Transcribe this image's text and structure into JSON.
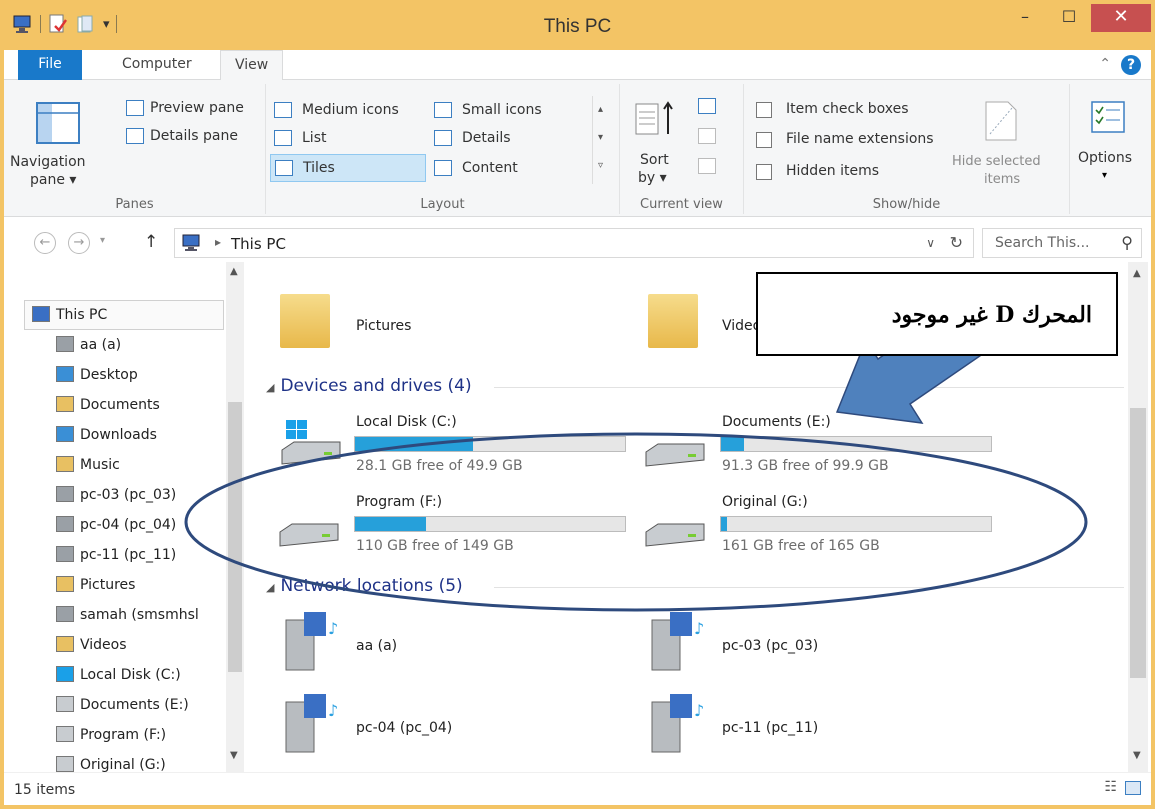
{
  "window": {
    "title": "This PC",
    "close_glyph": "✕",
    "min_glyph": "–",
    "max_glyph": "☐"
  },
  "tabs": {
    "file": "File",
    "computer": "Computer",
    "view": "View"
  },
  "ribbon": {
    "panes": {
      "navigation_pane": "Navigation",
      "navigation_pane2": "pane ▾",
      "preview_pane": "Preview pane",
      "details_pane": "Details pane",
      "group_label": "Panes"
    },
    "layout": {
      "medium_icons": "Medium icons",
      "small_icons": "Small icons",
      "list": "List",
      "details": "Details",
      "tiles": "Tiles",
      "content": "Content",
      "group_label": "Layout"
    },
    "current_view": {
      "sort_by": "Sort",
      "sort_by2": "by ▾",
      "group_label": "Current view"
    },
    "show_hide": {
      "item_check_boxes": "Item check boxes",
      "file_name_extensions": "File name extensions",
      "hidden_items": "Hidden items",
      "hide_selected": "Hide selected",
      "hide_selected2": "items",
      "group_label": "Show/hide"
    },
    "options": "Options"
  },
  "address": {
    "path": "This PC",
    "separator": "▸",
    "search_placeholder": "Search This...",
    "search_icon": "⚲"
  },
  "nav": {
    "items": [
      {
        "label": "This PC",
        "icon": "computer-icon"
      },
      {
        "label": "aa (a)",
        "icon": "network-drive-icon"
      },
      {
        "label": "Desktop",
        "icon": "desktop-folder-icon"
      },
      {
        "label": "Documents",
        "icon": "documents-folder-icon"
      },
      {
        "label": "Downloads",
        "icon": "downloads-folder-icon"
      },
      {
        "label": "Music",
        "icon": "music-folder-icon"
      },
      {
        "label": "pc-03 (pc_03)",
        "icon": "network-drive-icon"
      },
      {
        "label": "pc-04 (pc_04)",
        "icon": "network-drive-icon"
      },
      {
        "label": "pc-11 (pc_11)",
        "icon": "network-drive-icon"
      },
      {
        "label": "Pictures",
        "icon": "pictures-folder-icon"
      },
      {
        "label": "samah (smsmhsl",
        "icon": "network-drive-icon"
      },
      {
        "label": "Videos",
        "icon": "videos-folder-icon"
      },
      {
        "label": "Local Disk (C:)",
        "icon": "windows-drive-icon"
      },
      {
        "label": "Documents (E:)",
        "icon": "drive-icon"
      },
      {
        "label": "Program (F:)",
        "icon": "drive-icon"
      },
      {
        "label": "Original (G:)",
        "icon": "drive-icon"
      }
    ]
  },
  "content": {
    "folders": [
      {
        "label": "Pictures"
      },
      {
        "label": "Videos"
      }
    ],
    "devices_header": "Devices and drives (4)",
    "drives": [
      {
        "label": "Local Disk (C:)",
        "free": "28.1 GB free of 49.9 GB",
        "used_fraction": 0.437
      },
      {
        "label": "Documents (E:)",
        "free": "91.3 GB free of 99.9 GB",
        "used_fraction": 0.086
      },
      {
        "label": "Program (F:)",
        "free": "110 GB free of 149 GB",
        "used_fraction": 0.262
      },
      {
        "label": "Original (G:)",
        "free": "161 GB free of 165 GB",
        "used_fraction": 0.024
      }
    ],
    "network_header": "Network locations (5)",
    "network": [
      {
        "label": "aa (a)"
      },
      {
        "label": "pc-03 (pc_03)"
      },
      {
        "label": "pc-04 (pc_04)"
      },
      {
        "label": "pc-11 (pc_11)"
      }
    ]
  },
  "status": {
    "count": "15 items"
  },
  "annotation": {
    "text": "المحرك D غير موجود"
  },
  "colors": {
    "title_bar": "#f3c465",
    "accent": "#1979ca",
    "bar_fill": "#26a0da",
    "annotation_arrow": "#4f81bd",
    "ellipse_stroke": "#2e4a7d"
  }
}
